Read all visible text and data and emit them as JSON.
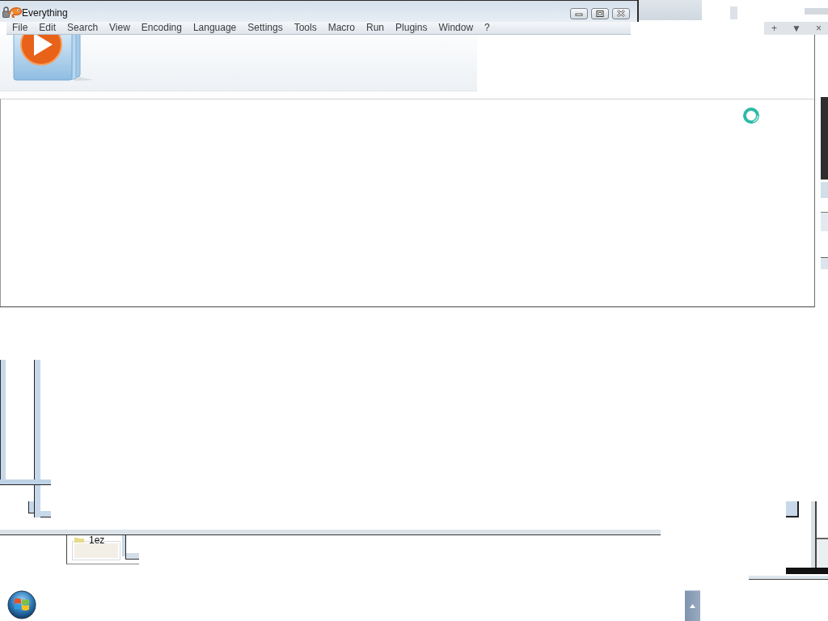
{
  "window": {
    "title": "Everything"
  },
  "menu_bar": {
    "items": [
      "File",
      "Edit",
      "Search",
      "View",
      "Encoding",
      "Language",
      "Settings",
      "Tools",
      "Macro",
      "Run",
      "Plugins",
      "Window",
      "?"
    ]
  },
  "tab_controls": [
    "+",
    "▼",
    "×"
  ],
  "desktop_fragment": {
    "label": "1ez"
  }
}
